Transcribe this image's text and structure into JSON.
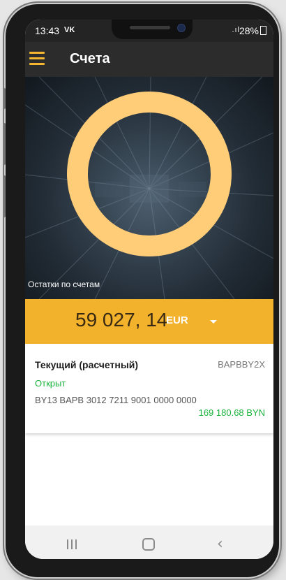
{
  "status_bar": {
    "time": "13:43",
    "app_icon": "vk-icon",
    "network": ".ıl",
    "battery": "28%"
  },
  "app_bar": {
    "title": "Счета",
    "menu_icon": "hamburger-menu-icon"
  },
  "hero": {
    "label": "Остатки по счетам",
    "ring_color": "#ffcc78"
  },
  "balance": {
    "amount": "59 027, 14",
    "currency": "EUR",
    "bg_color": "#f2b22b"
  },
  "accounts": [
    {
      "name": "Текущий (расчетный)",
      "bic": "BAPBBY2X",
      "status": "Открыт",
      "iban": "BY13 BAPB 3012 7211 9001 0000 0000",
      "amount": "169 180.68 BYN"
    }
  ],
  "nav_bar": {
    "recent_icon": "recent-apps-icon",
    "home_icon": "home-icon",
    "back_icon": "back-icon"
  }
}
